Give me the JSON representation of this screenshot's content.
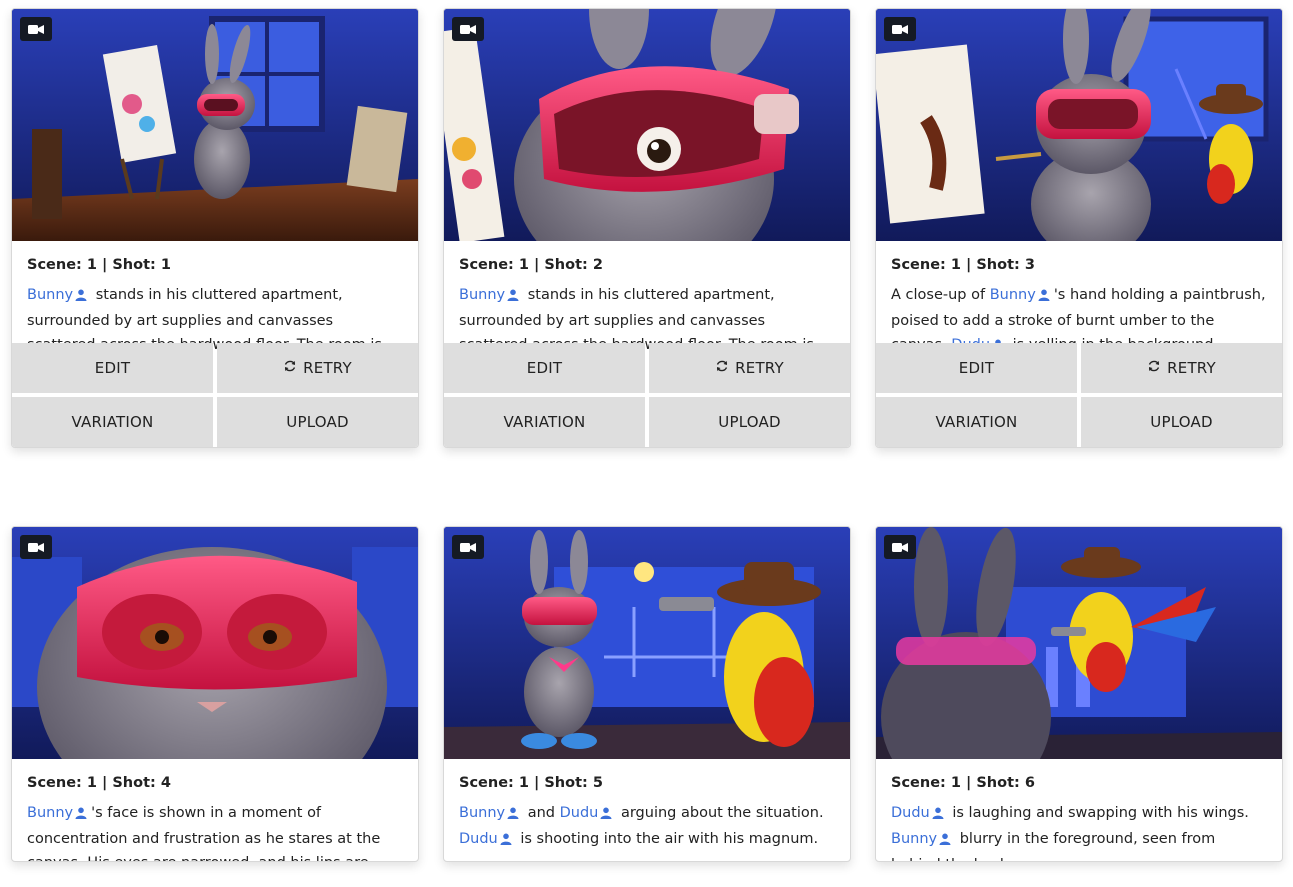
{
  "cards": [
    {
      "title": "Scene: 1 | Shot: 1",
      "desc": [
        {
          "char": "Bunny"
        },
        {
          "text": " stands in his cluttered apartment, surrounded by art supplies and canvasses scattered across the hardwood floor. The room is bathed in soft moonlight."
        }
      ],
      "buttons": {
        "edit": "EDIT",
        "retry": "RETRY",
        "variation": "VARIATION",
        "upload": "UPLOAD"
      },
      "image": "bunny-painting-apartment"
    },
    {
      "title": "Scene: 1 | Shot: 2",
      "desc": [
        {
          "char": "Bunny"
        },
        {
          "text": " stands in his cluttered apartment, surrounded by art supplies and canvasses scattered across the hardwood floor. The room is bathed in soft moonlight."
        }
      ],
      "buttons": {
        "edit": "EDIT",
        "retry": "RETRY",
        "variation": "VARIATION",
        "upload": "UPLOAD"
      },
      "image": "bunny-closeup-goggles"
    },
    {
      "title": "Scene: 1 | Shot: 3",
      "desc": [
        {
          "text": "A close-up of "
        },
        {
          "char": "Bunny"
        },
        {
          "text": "'s hand holding a paintbrush, poised to add a stroke of burnt umber to the canvas. "
        },
        {
          "char": "Dudu"
        },
        {
          "text": " is yelling in the background."
        }
      ],
      "buttons": {
        "edit": "EDIT",
        "retry": "RETRY",
        "variation": "VARIATION",
        "upload": "UPLOAD"
      },
      "image": "bunny-painting-parrot"
    },
    {
      "title": "Scene: 1 | Shot: 4",
      "desc": [
        {
          "char": "Bunny"
        },
        {
          "text": "'s face is shown in a moment of concentration and frustration as he stares at the canvas. His eyes are narrowed, and his lips are pressed together."
        }
      ],
      "image": "bunny-face-closeup"
    },
    {
      "title": "Scene: 1 | Shot: 5",
      "desc": [
        {
          "char": "Bunny"
        },
        {
          "text": " and "
        },
        {
          "char": "Dudu"
        },
        {
          "text": " arguing about the situation. "
        },
        {
          "char": "Dudu"
        },
        {
          "text": " is shooting into the air with his magnum."
        }
      ],
      "image": "bunny-parrot-gun"
    },
    {
      "title": "Scene: 1 | Shot: 6",
      "desc": [
        {
          "char": "Dudu"
        },
        {
          "text": " is laughing and swapping with his wings. "
        },
        {
          "char": "Bunny"
        },
        {
          "text": " blurry in the foreground, seen from behind the back."
        }
      ],
      "image": "parrot-flying-bunny-back"
    }
  ],
  "icons": {
    "camera": "video-camera-icon",
    "person": "person-icon",
    "retry": "refresh-icon"
  },
  "colors": {
    "character_link": "#3b6fd8",
    "button_bg": "#dedede",
    "badge_bg": "#151a24"
  }
}
